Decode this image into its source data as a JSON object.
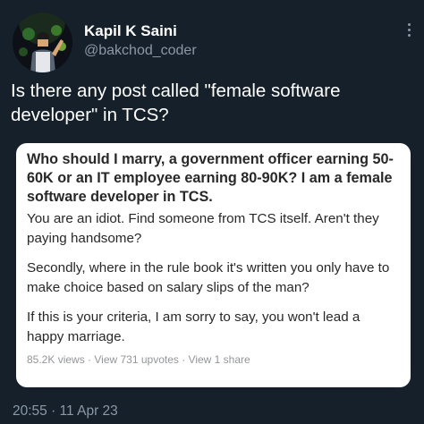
{
  "user": {
    "display_name": "Kapil K Saini",
    "handle": "@bakchod_coder"
  },
  "tweet": {
    "text": "Is there any post called \"female software developer\" in TCS?",
    "timestamp": "20:55 · 11 Apr 23"
  },
  "quora_card": {
    "question": "Who should I marry, a government officer earning 50-60K or an IT employee earning 80-90K? I am a female software developer in TCS.",
    "paragraphs": [
      "You are an idiot. Find someone from TCS itself. Aren't they paying handsome?",
      "Secondly, where in the rule book it's written you only have to make choice based on salary slips of the man?",
      "If this is your criteria, I am sorry to say, you won't lead a happy marriage."
    ],
    "stats": "85.2K views · View 731 upvotes · View 1 share"
  },
  "icons": {
    "more": "more-vertical-icon"
  },
  "colors": {
    "background": "#15202b",
    "secondary_text": "#8b98a5",
    "card_background": "#ffffff",
    "card_text": "#282829"
  }
}
